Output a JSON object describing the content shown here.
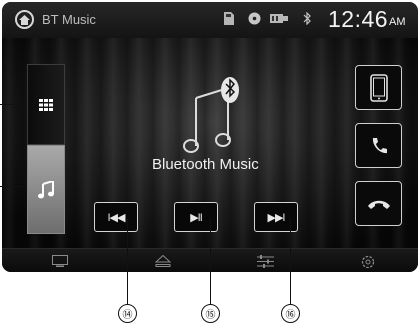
{
  "topbar": {
    "source_title": "BT Music",
    "icons": [
      "home-icon",
      "sd-card-icon",
      "disc-icon",
      "usb-icon",
      "bluetooth-icon"
    ],
    "clock_time": "12:46",
    "clock_ampm": "AM"
  },
  "left_sidebar": [
    {
      "icon": "grid-menu-icon",
      "active": false
    },
    {
      "icon": "music-note-icon",
      "active": true
    }
  ],
  "right_sidebar": [
    {
      "icon": "smartphone-icon"
    },
    {
      "icon": "phone-call-icon"
    },
    {
      "icon": "hang-up-icon"
    }
  ],
  "main": {
    "track_title": "Bluetooth Music"
  },
  "controls": {
    "prev_glyph": "I◀◀",
    "play_pause_glyph": "▶II",
    "next_glyph": "▶▶I"
  },
  "bottombar": {
    "icons": [
      "display-icon",
      "eject-icon",
      "equalizer-icon",
      "settings-icon"
    ]
  },
  "callouts": [
    "⑭",
    "⑮",
    "⑯"
  ],
  "colors": {
    "active_tab": "#8c8c8c",
    "text": "#f1f1f1",
    "button_border": "#d5d5d5"
  }
}
